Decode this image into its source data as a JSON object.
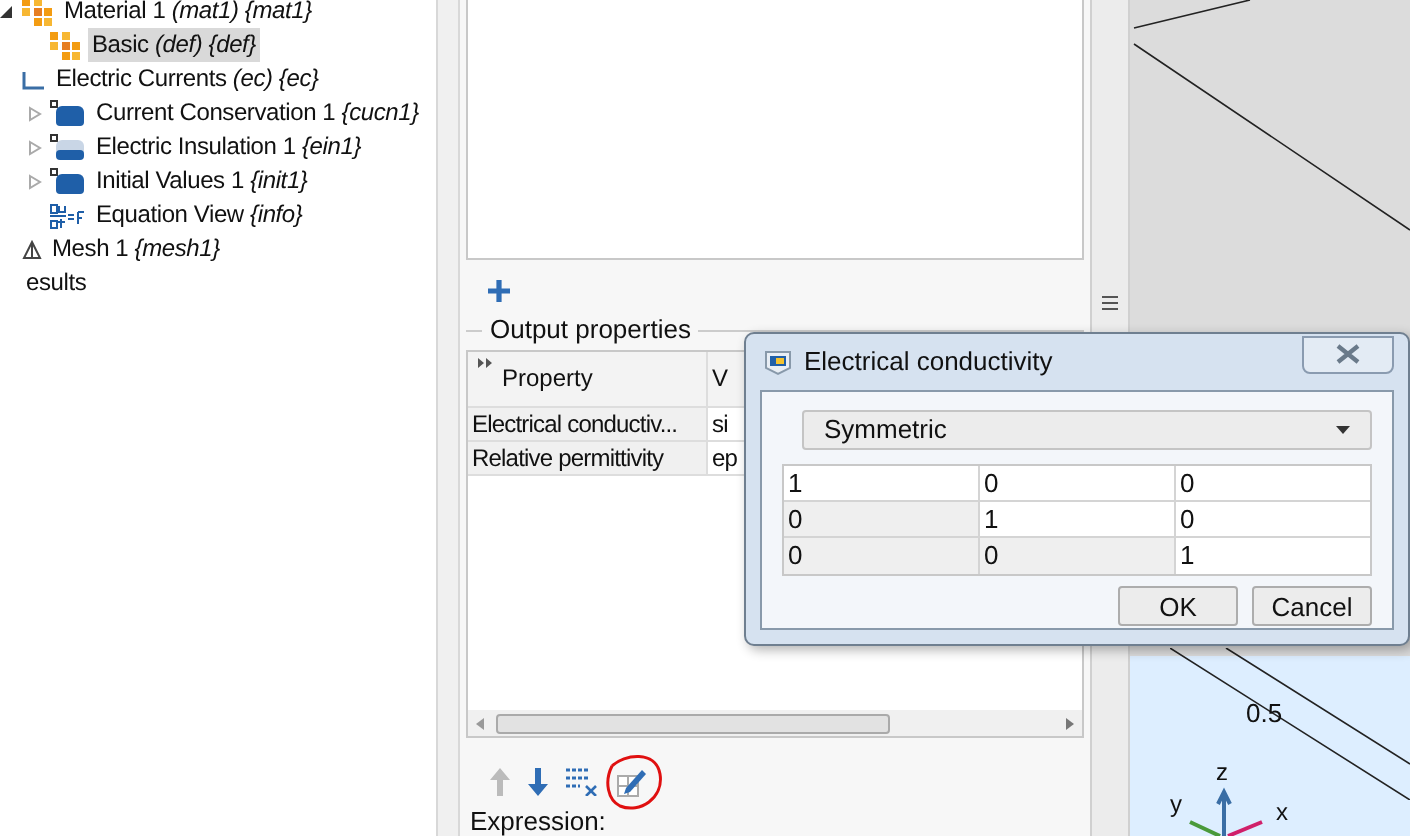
{
  "tree": [
    {
      "label": "Material 1 *(mat1) {mat1}*",
      "kind": "material",
      "expanded": true,
      "selected": false,
      "children": [
        {
          "label": "Basic *(def) {def}*",
          "kind": "material",
          "selected": true
        }
      ]
    },
    {
      "label": "Electric Currents *(ec) {ec}*",
      "kind": "physics",
      "selected": false,
      "children": [
        {
          "label": "Current Conservation 1 *{cucn1}*",
          "kind": "feature",
          "expanded": false,
          "selected": false
        },
        {
          "label": "Electric Insulation 1 *{ein1}*",
          "kind": "boundary",
          "expanded": false,
          "selected": false
        },
        {
          "label": "Initial Values 1 *{init1}*",
          "kind": "feature",
          "expanded": false,
          "selected": false
        },
        {
          "label": "Equation View *{info}*",
          "kind": "equation",
          "selected": false
        }
      ]
    },
    {
      "label": "Mesh 1 *{mesh1}*",
      "kind": "mesh",
      "selected": false
    },
    {
      "label": "esults",
      "kind": "none",
      "selected": false
    }
  ],
  "output_properties": {
    "title": "Output properties",
    "columns": [
      "Property",
      "V"
    ],
    "rows": [
      [
        "Electrical conductiv...",
        "si"
      ],
      [
        "Relative permittivity",
        "ep"
      ]
    ]
  },
  "toolbar": [
    {
      "kind": "up",
      "disabled": true
    },
    {
      "kind": "down",
      "disabled": false
    },
    {
      "kind": "clear",
      "disabled": false
    },
    {
      "kind": "edit",
      "disabled": false
    }
  ],
  "expression_label": "Expression:",
  "graphics": {
    "axis_value": "0.5",
    "axes": [
      "z",
      "y",
      "x"
    ]
  },
  "dialog": {
    "title": "Electrical conductivity",
    "mode": "Symmetric",
    "cells": [
      [
        {
          "value": "1",
          "disabled": false
        },
        {
          "value": "0",
          "disabled": false
        },
        {
          "value": "0",
          "disabled": false
        }
      ],
      [
        {
          "value": "0",
          "disabled": true
        },
        {
          "value": "1",
          "disabled": false
        },
        {
          "value": "0",
          "disabled": false
        }
      ],
      [
        {
          "value": "0",
          "disabled": true
        },
        {
          "value": "0",
          "disabled": true
        },
        {
          "value": "1",
          "disabled": false
        }
      ]
    ],
    "buttons": [
      "OK",
      "Cancel"
    ]
  }
}
